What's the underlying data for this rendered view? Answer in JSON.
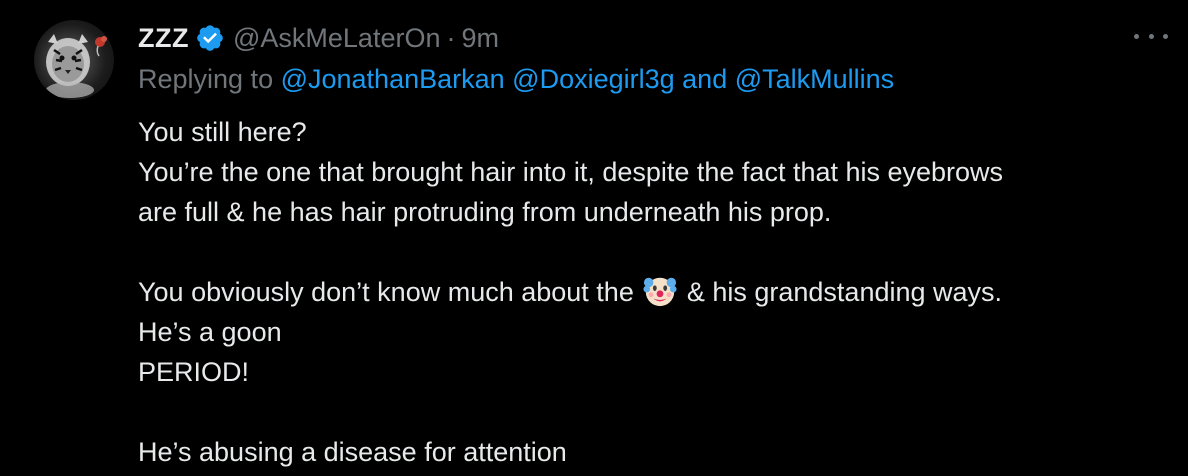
{
  "tweet": {
    "display_name": "ZZZ",
    "handle": "@AskMeLaterOn",
    "separator": "·",
    "time": "9m",
    "replying_prefix": "Replying to ",
    "mentions": [
      "@JonathanBarkan",
      "@Doxiegirl3g",
      "@TalkMullins"
    ],
    "mention_joiner_space": " ",
    "mention_joiner_and": " and ",
    "body_lines": [
      "You still here?",
      "You’re the one that brought hair into it, despite the fact that his eyebrows",
      "are full & he has hair protruding from underneath his prop.",
      "",
      "You obviously don’t know much about the ",
      " & his grandstanding ways.",
      "He’s a goon",
      "PERIOD!",
      "",
      "He’s abusing a disease for attention"
    ],
    "emoji": "clown-face-emoji"
  },
  "icons": {
    "verified": "verified-badge-icon",
    "more": "more-options-icon",
    "avatar": "tiger-avatar"
  },
  "colors": {
    "background": "#000000",
    "text": "#e7e9ea",
    "secondary": "#71767b",
    "link": "#1d9bf0",
    "verified": "#1d9bf0"
  }
}
